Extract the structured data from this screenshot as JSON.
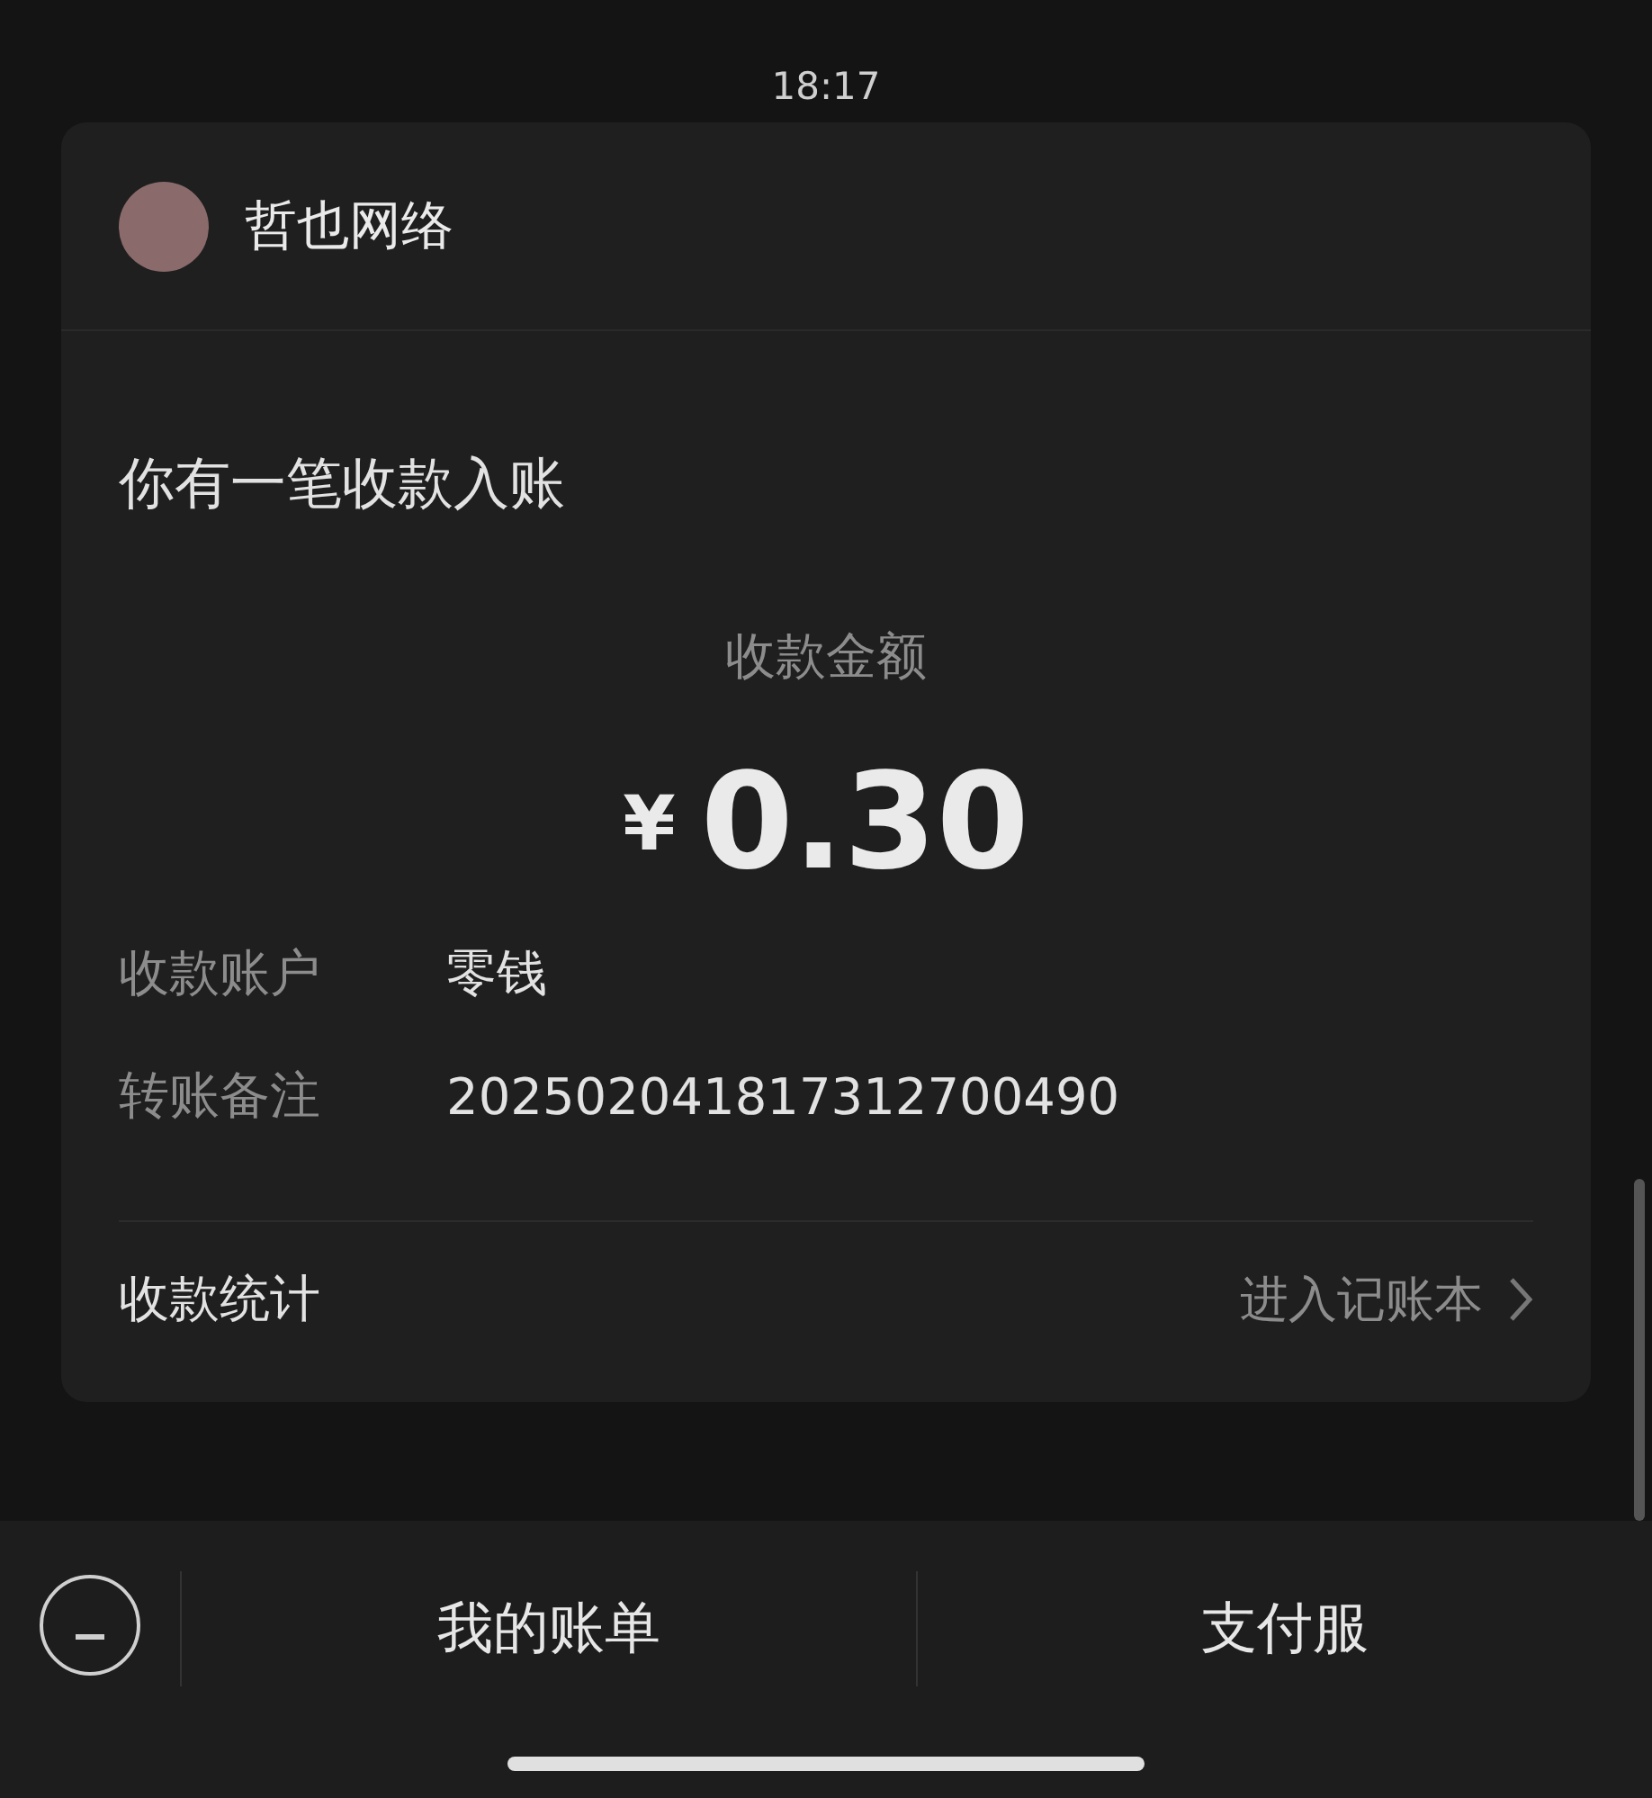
{
  "status_bar": {
    "time": "18:17"
  },
  "card": {
    "sender": "哲也网络",
    "title": "你有一笔收款入账",
    "amount_label": "收款金额",
    "currency": "¥",
    "amount": "0.30",
    "details": [
      {
        "label": "收款账户",
        "value": "零钱"
      },
      {
        "label": "转账备注",
        "value": "202502041817312700490"
      }
    ],
    "footer": {
      "label": "收款统计",
      "link": "进入记账本"
    }
  },
  "bottom_menu": {
    "items": [
      "我的账单",
      "支付服"
    ]
  }
}
